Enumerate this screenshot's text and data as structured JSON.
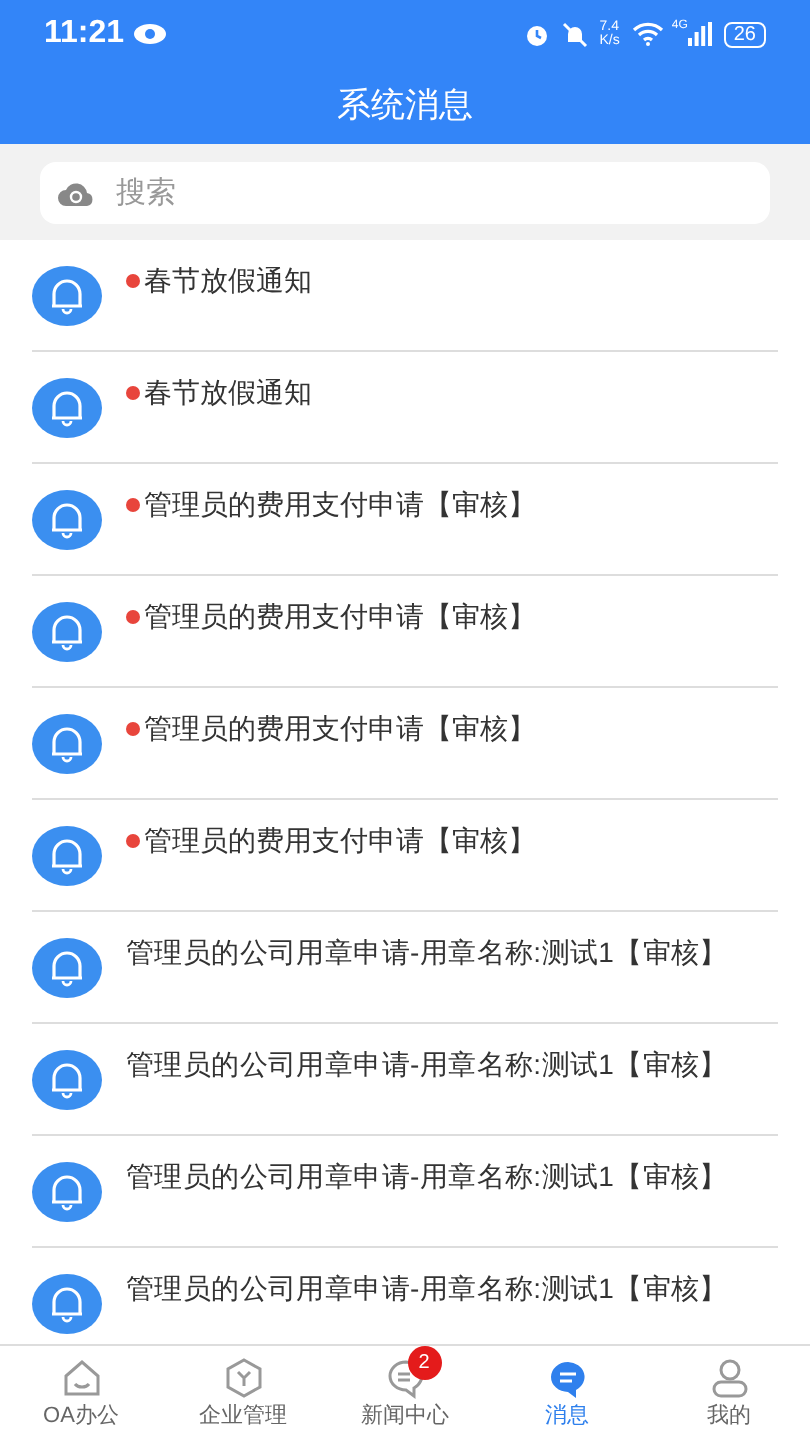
{
  "status_bar": {
    "time": "11:21",
    "net_speed_value": "7.4",
    "net_speed_unit": "K/s",
    "network": "4G",
    "battery": "26"
  },
  "header": {
    "title": "系统消息"
  },
  "search": {
    "placeholder": "搜索"
  },
  "messages": [
    {
      "title": "春节放假通知",
      "unread": true
    },
    {
      "title": "春节放假通知",
      "unread": true
    },
    {
      "title": "管理员的费用支付申请【审核】",
      "unread": true
    },
    {
      "title": "管理员的费用支付申请【审核】",
      "unread": true
    },
    {
      "title": "管理员的费用支付申请【审核】",
      "unread": true
    },
    {
      "title": "管理员的费用支付申请【审核】",
      "unread": true
    },
    {
      "title": "管理员的公司用章申请-用章名称:测试1【审核】",
      "unread": false
    },
    {
      "title": "管理员的公司用章申请-用章名称:测试1【审核】",
      "unread": false
    },
    {
      "title": "管理员的公司用章申请-用章名称:测试1【审核】",
      "unread": false
    },
    {
      "title": "管理员的公司用章申请-用章名称:测试1【审核】",
      "unread": false
    }
  ],
  "tab_bar": [
    {
      "kind": "home",
      "label": "OA办公",
      "selected": false
    },
    {
      "kind": "hexagon",
      "label": "企业管理",
      "selected": false
    },
    {
      "kind": "chat",
      "label": "新闻中心",
      "selected": false,
      "badge": "2"
    },
    {
      "kind": "message",
      "label": "消息",
      "selected": true
    },
    {
      "kind": "person",
      "label": "我的",
      "selected": false
    }
  ]
}
